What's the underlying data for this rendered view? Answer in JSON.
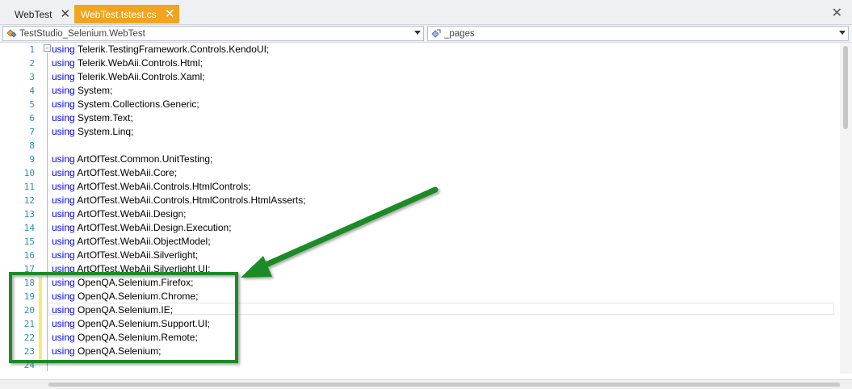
{
  "tabs": [
    {
      "label": "WebTest",
      "active": false
    },
    {
      "label": "WebTest.tstest.cs",
      "active": true
    }
  ],
  "window": {
    "close_icon": "close-icon"
  },
  "nav": {
    "type_combo": "TestStudio_Selenium.WebTest",
    "member_combo": "_pages"
  },
  "colors": {
    "keyword": "#0000ff",
    "line_number": "#2b91af",
    "active_tab": "#f1a51f",
    "annotation": "#1e8b25",
    "change_marker": "#fbe86f"
  },
  "code": {
    "keyword": "using",
    "lines": [
      {
        "n": "1",
        "ns": "Telerik.TestingFramework.Controls.KendoUI;"
      },
      {
        "n": "2",
        "ns": "Telerik.WebAii.Controls.Html;"
      },
      {
        "n": "3",
        "ns": "Telerik.WebAii.Controls.Xaml;"
      },
      {
        "n": "4",
        "ns": "System;"
      },
      {
        "n": "5",
        "ns": "System.Collections.Generic;"
      },
      {
        "n": "6",
        "ns": "System.Text;"
      },
      {
        "n": "7",
        "ns": "System.Linq;"
      },
      {
        "n": "8",
        "ns": ""
      },
      {
        "n": "9",
        "ns": "ArtOfTest.Common.UnitTesting;"
      },
      {
        "n": "10",
        "ns": "ArtOfTest.WebAii.Core;"
      },
      {
        "n": "11",
        "ns": "ArtOfTest.WebAii.Controls.HtmlControls;"
      },
      {
        "n": "12",
        "ns": "ArtOfTest.WebAii.Controls.HtmlControls.HtmlAsserts;"
      },
      {
        "n": "13",
        "ns": "ArtOfTest.WebAii.Design;"
      },
      {
        "n": "14",
        "ns": "ArtOfTest.WebAii.Design.Execution;"
      },
      {
        "n": "15",
        "ns": "ArtOfTest.WebAii.ObjectModel;"
      },
      {
        "n": "16",
        "ns": "ArtOfTest.WebAii.Silverlight;"
      },
      {
        "n": "17",
        "ns": "ArtOfTest.WebAii.Silverlight.UI;"
      },
      {
        "n": "18",
        "ns": "OpenQA.Selenium.Firefox;"
      },
      {
        "n": "19",
        "ns": "OpenQA.Selenium.Chrome;"
      },
      {
        "n": "20",
        "ns": "OpenQA.Selenium.IE;"
      },
      {
        "n": "21",
        "ns": "OpenQA.Selenium.Support.UI;"
      },
      {
        "n": "22",
        "ns": "OpenQA.Selenium.Remote;"
      },
      {
        "n": "23",
        "ns": "OpenQA.Selenium;"
      },
      {
        "n": "24",
        "ns": ""
      }
    ]
  }
}
